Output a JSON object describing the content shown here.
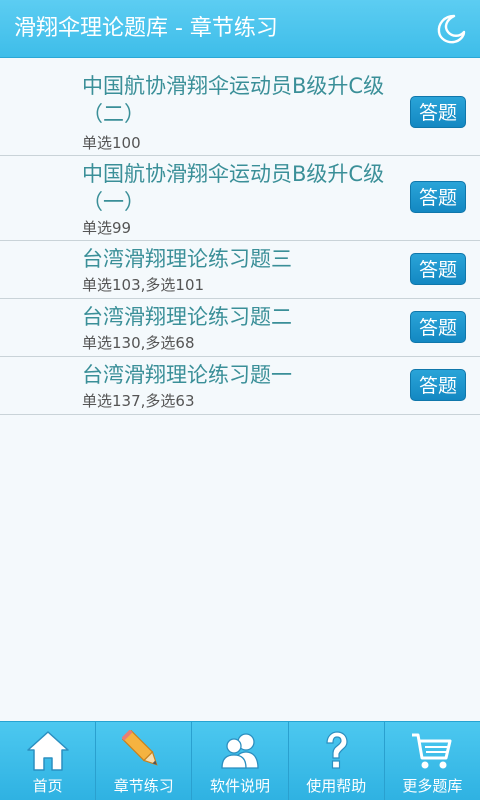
{
  "header": {
    "title": "滑翔伞理论题库 - 章节练习",
    "night_mode_icon": "moon-icon"
  },
  "items": [
    {
      "title": "中国航协滑翔伞运动员B级升C级（二）",
      "subtitle": "单选100",
      "button": "答题"
    },
    {
      "title": "中国航协滑翔伞运动员B级升C级（一）",
      "subtitle": "单选99",
      "button": "答题"
    },
    {
      "title": "台湾滑翔理论练习题三",
      "subtitle": "单选103,多选101",
      "button": "答题"
    },
    {
      "title": "台湾滑翔理论练习题二",
      "subtitle": "单选130,多选68",
      "button": "答题"
    },
    {
      "title": "台湾滑翔理论练习题一",
      "subtitle": "单选137,多选63",
      "button": "答题"
    }
  ],
  "tabs": [
    {
      "label": "首页",
      "icon": "home-icon"
    },
    {
      "label": "章节练习",
      "icon": "pencil-icon"
    },
    {
      "label": "软件说明",
      "icon": "users-icon"
    },
    {
      "label": "使用帮助",
      "icon": "help-icon"
    },
    {
      "label": "更多题库",
      "icon": "cart-icon"
    }
  ],
  "colors": {
    "header": "#3ebde9",
    "title_text": "#3a8f98",
    "button": "#1388c2"
  }
}
